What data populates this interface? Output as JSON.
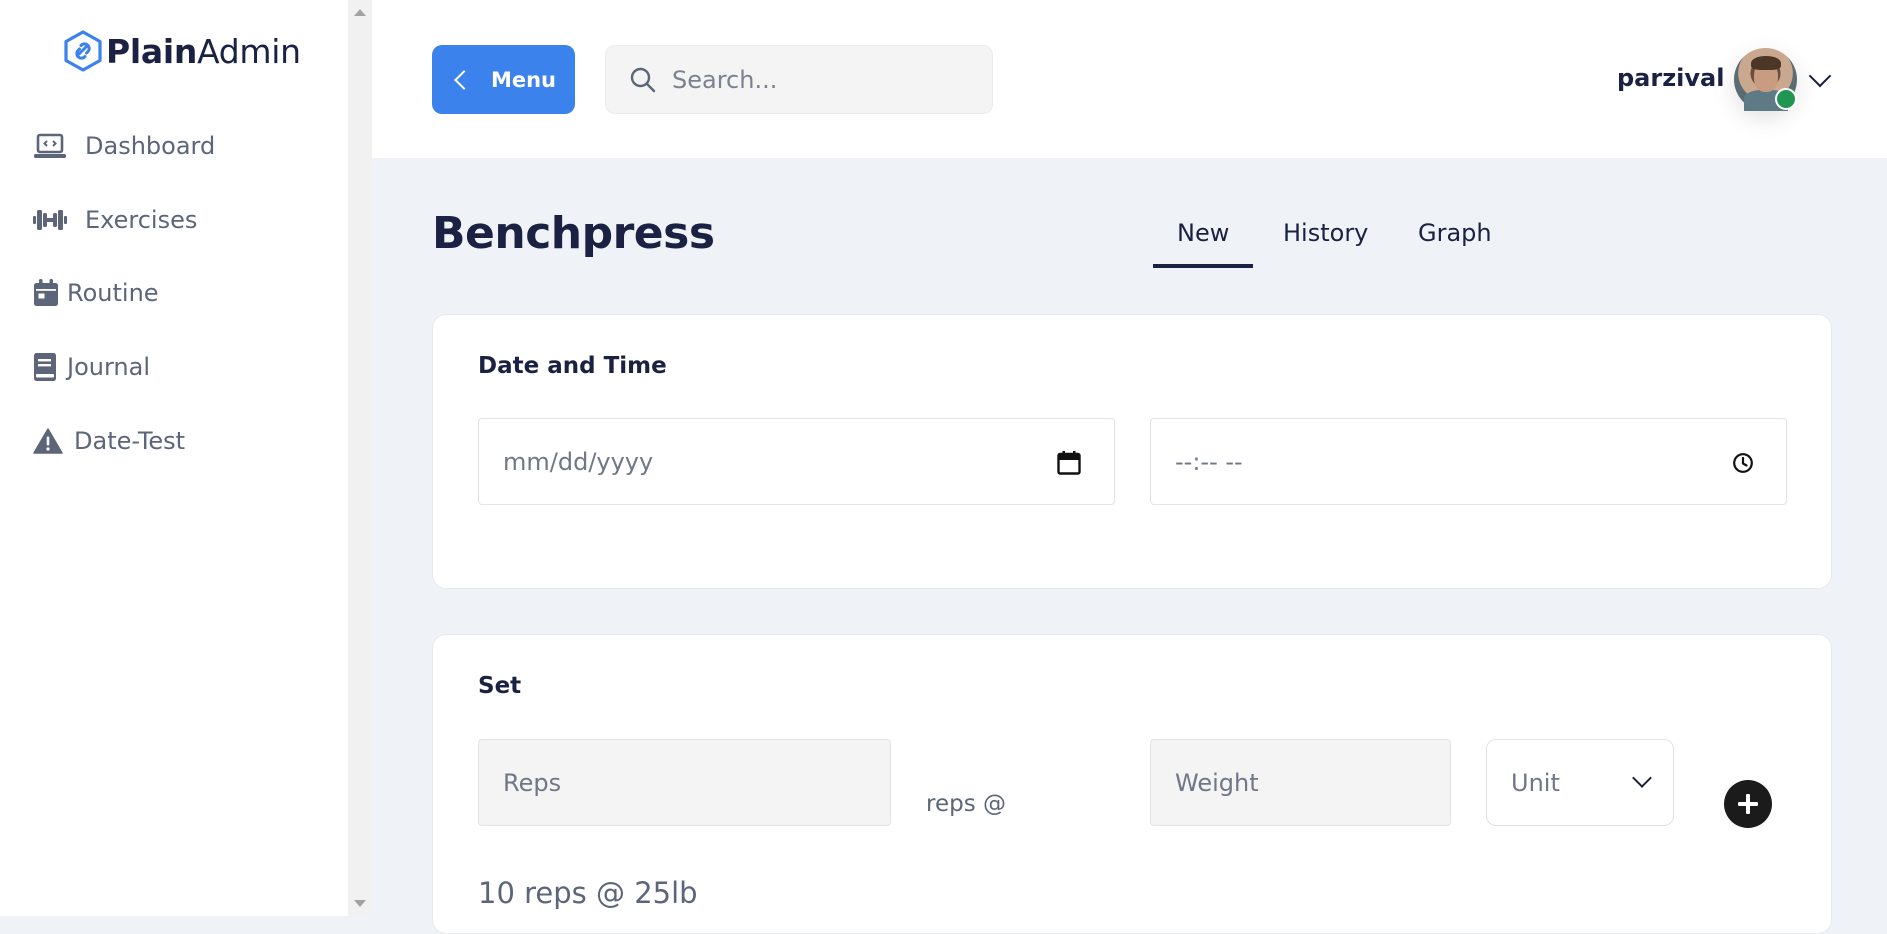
{
  "brand": {
    "name_bold": "Plain",
    "name_light": "Admin"
  },
  "sidebar": {
    "items": [
      {
        "label": "Dashboard",
        "icon": "laptop-code-icon"
      },
      {
        "label": "Exercises",
        "icon": "dumbbell-icon"
      },
      {
        "label": "Routine",
        "icon": "calendar-icon"
      },
      {
        "label": "Journal",
        "icon": "book-icon"
      },
      {
        "label": "Date-Test",
        "icon": "warning-icon"
      }
    ]
  },
  "header": {
    "menu_label": "Menu",
    "search_placeholder": "Search...",
    "username": "parzival"
  },
  "page": {
    "title": "Benchpress",
    "tabs": [
      "New",
      "History",
      "Graph"
    ],
    "active_tab": "New"
  },
  "datetime_card": {
    "title": "Date and Time",
    "date_placeholder": "mm/dd/yyyy",
    "time_placeholder": "--:-- --"
  },
  "set_card": {
    "title": "Set",
    "reps_placeholder": "Reps",
    "reps_at_label": "reps @",
    "weight_placeholder": "Weight",
    "unit_label": "Unit",
    "summary": "10 reps @ 25lb"
  },
  "colors": {
    "accent": "#3b82ed",
    "status_online": "#219653",
    "background": "#eff2f6",
    "text": "#1a2142"
  }
}
